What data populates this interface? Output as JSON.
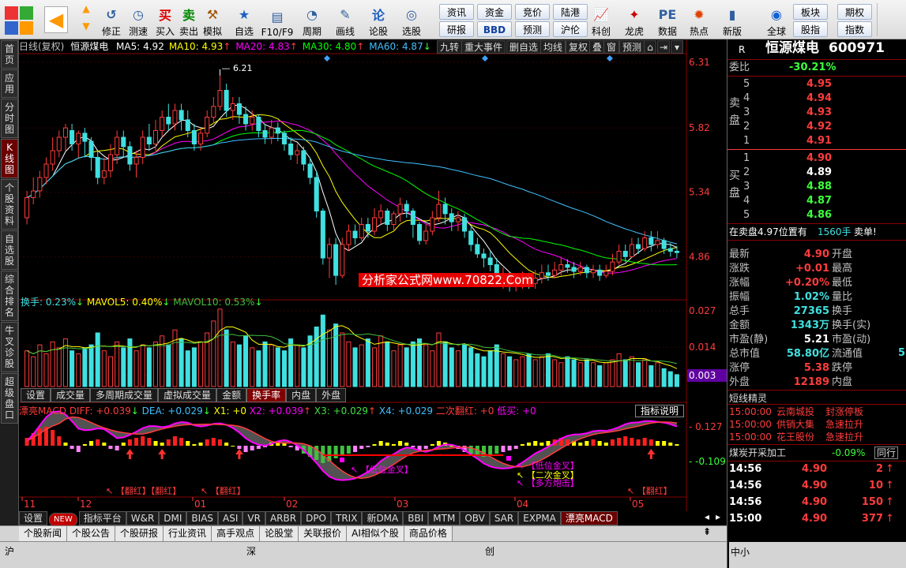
{
  "toolbar": {
    "buttons": [
      {
        "label": "修正",
        "icon": "undo-icon"
      },
      {
        "label": "测速",
        "icon": "timer-icon"
      },
      {
        "label": "买入",
        "icon": "buy-icon"
      },
      {
        "label": "卖出",
        "icon": "sell-icon"
      },
      {
        "label": "模拟",
        "icon": "hammer-icon"
      },
      {
        "label": "自选",
        "icon": "star-icon"
      },
      {
        "label": "F10/F9",
        "icon": "f10-icon"
      },
      {
        "label": "周期",
        "icon": "period-icon"
      },
      {
        "label": "画线",
        "icon": "pencil-icon"
      },
      {
        "label": "论股",
        "icon": "forum-icon"
      },
      {
        "label": "选股",
        "icon": "screener-icon"
      },
      {
        "label": "资讯"
      },
      {
        "label": "研报"
      },
      {
        "label": "资金"
      },
      {
        "label": "BBD"
      },
      {
        "label": "竞价"
      },
      {
        "label": "预测"
      },
      {
        "label": "陆港"
      },
      {
        "label": "沪伦"
      },
      {
        "label": "科创",
        "icon": "chart-icon"
      },
      {
        "label": "龙虎",
        "icon": "dragon-icon"
      },
      {
        "label": "数据",
        "icon": "pe-icon"
      },
      {
        "label": "热点",
        "icon": "hot-icon"
      },
      {
        "label": "新版",
        "icon": "new-icon"
      },
      {
        "label": "全球",
        "icon": "globe-icon"
      },
      {
        "label": "板块"
      },
      {
        "label": "指数"
      },
      {
        "label": "股指"
      },
      {
        "label": "期权"
      }
    ]
  },
  "leftnav": [
    "首页",
    "应用",
    "分时图",
    "K线图",
    "个股资料",
    "自选股",
    "综合排名",
    "牛叉诊股",
    "超级盘口"
  ],
  "chart_header": {
    "period": "日线(复权)",
    "stock": "恒源煤电",
    "ma": [
      {
        "name": "MA5",
        "value": "4.92",
        "color": "#ffffff",
        "dir": ""
      },
      {
        "name": "MA10",
        "value": "4.93",
        "color": "#ffff00",
        "dir": "↑"
      },
      {
        "name": "MA20",
        "value": "4.83",
        "color": "#ff00ff",
        "dir": "↑"
      },
      {
        "name": "MA30",
        "value": "4.80",
        "color": "#00ff00",
        "dir": "↑"
      },
      {
        "name": "MA60",
        "value": "4.87",
        "color": "#40c0ff",
        "dir": "↓"
      }
    ],
    "tabs": [
      "九转",
      "重大事件",
      "删自选",
      "均线",
      "复权",
      "叠",
      "窗",
      "预测"
    ]
  },
  "price_axis": [
    "6.31",
    "5.82",
    "5.34",
    "4.86"
  ],
  "high_label": "6.21",
  "watermark": "分析家公式网www.70822.Com",
  "volume": {
    "label": "换手: 0.23%",
    "mavol5": "MAVOL5: 0.40%",
    "mavol10": "MAVOL10: 0.53%",
    "axis": [
      "0.027",
      "0.014",
      "0.003"
    ]
  },
  "subtabs": [
    "设置",
    "成交量",
    "多周期成交量",
    "虚拟成交量",
    "金额",
    "换手率",
    "内盘",
    "外盘"
  ],
  "macd": {
    "title": "漂亮MACD",
    "diff": "DIFF: +0.039",
    "dea": "DEA: +0.029",
    "x1": "X1: +0",
    "x2": "X2: +0.039",
    "x3": "X3: +0.029",
    "x4": "X4: +0.029",
    "ercizh": "二次翻红: +0",
    "dimai": "低买: +0",
    "explain": "指标说明",
    "axis": [
      "0.127",
      "-0.109"
    ],
    "signals": [
      "【翻红】【翻红】",
      "【翻红】",
      "【低位金叉】",
      "【低位金叉】",
      "【二次金叉】",
      "【多方炮击】",
      "【翻红】"
    ]
  },
  "date_axis": [
    "11",
    "12",
    "01",
    "02",
    "03",
    "04",
    "05"
  ],
  "bottom_tabs": [
    "设置",
    "NEW",
    "指标平台",
    "W&R",
    "DMI",
    "BIAS",
    "ASI",
    "VR",
    "ARBR",
    "DPO",
    "TRIX",
    "新DMA",
    "BBI",
    "MTM",
    "OBV",
    "SAR",
    "EXPMA",
    "漂亮MACD"
  ],
  "content_tabs": [
    "个股新闻",
    "个股公告",
    "个股研报",
    "行业资讯",
    "高手观点",
    "论股堂",
    "关联报价",
    "AI相似个股",
    "商品价格"
  ],
  "status": {
    "sh": "沪",
    "sz": "深",
    "cy": "创"
  },
  "quote": {
    "badge": "R",
    "name": "恒源煤电",
    "code": "600971",
    "weibi_label": "委比",
    "weibi": "-30.21%",
    "sell_label": "卖盘",
    "buy_label": "买盘",
    "sells": [
      {
        "n": "5",
        "p": "4.95"
      },
      {
        "n": "4",
        "p": "4.94"
      },
      {
        "n": "3",
        "p": "4.93"
      },
      {
        "n": "2",
        "p": "4.92"
      },
      {
        "n": "1",
        "p": "4.91"
      }
    ],
    "buys": [
      {
        "n": "1",
        "p": "4.90"
      },
      {
        "n": "2",
        "p": "4.89"
      },
      {
        "n": "3",
        "p": "4.88"
      },
      {
        "n": "4",
        "p": "4.87"
      },
      {
        "n": "5",
        "p": "4.86"
      }
    ],
    "order_line": "在卖盘4.97位置有",
    "order_qty": "1560手",
    "order_tag": "卖单!",
    "stats": [
      {
        "l": "最新",
        "v": "4.90",
        "vc": "red",
        "r": "开盘"
      },
      {
        "l": "涨跌",
        "v": "+0.01",
        "vc": "red",
        "r": "最高"
      },
      {
        "l": "涨幅",
        "v": "+0.20%",
        "vc": "red",
        "r": "最低"
      },
      {
        "l": "振幅",
        "v": "1.02%",
        "vc": "cyan",
        "r": "量比"
      },
      {
        "l": "总手",
        "v": "27365",
        "vc": "cyan",
        "r": "换手"
      },
      {
        "l": "金额",
        "v": "1343万",
        "vc": "cyan",
        "r": "换手(实)"
      },
      {
        "l": "市盈(静)",
        "v": "5.21",
        "vc": "white",
        "r": "市盈(动)"
      },
      {
        "l": "总市值",
        "v": "58.80亿",
        "vc": "cyan",
        "r": "流通值"
      },
      {
        "l": "涨停",
        "v": "5.38",
        "vc": "red",
        "r": "跌停"
      },
      {
        "l": "外盘",
        "v": "12189",
        "vc": "red",
        "r": "内盘"
      }
    ],
    "short_title": "短线精灵",
    "alerts": [
      {
        "t": "15:00:00",
        "s": "云南城投",
        "e": "封涨停板"
      },
      {
        "t": "15:00:00",
        "s": "供销大集",
        "e": "急速拉升"
      },
      {
        "t": "15:00:00",
        "s": "花王股份",
        "e": "急速拉升"
      }
    ],
    "sector": "煤炭开采加工",
    "sector_pct": "-0.09%",
    "sector_btn": "同行",
    "ticks": [
      {
        "t": "14:56",
        "p": "4.90",
        "q": "2",
        "d": "↑"
      },
      {
        "t": "14:56",
        "p": "4.90",
        "q": "10",
        "d": "↑"
      },
      {
        "t": "14:56",
        "p": "4.90",
        "q": "150",
        "d": "↑"
      },
      {
        "t": "15:00",
        "p": "4.90",
        "q": "377",
        "d": "↑"
      }
    ],
    "footer": "中小"
  },
  "chart_data": {
    "type": "candlestick",
    "title": "日线(复权) 恒源煤电",
    "yaxis_ticks": [
      6.31,
      5.82,
      5.34,
      4.86
    ],
    "ylim": [
      4.55,
      6.35
    ],
    "x_month_labels": [
      "11",
      "12",
      "01",
      "02",
      "03",
      "04",
      "05"
    ],
    "candles": [
      [
        5.15,
        5.3,
        5.35,
        5.1
      ],
      [
        5.3,
        5.35,
        5.45,
        5.25
      ],
      [
        5.35,
        5.45,
        5.5,
        5.3
      ],
      [
        5.45,
        5.55,
        5.6,
        5.4
      ],
      [
        5.55,
        5.65,
        5.75,
        5.5
      ],
      [
        5.65,
        5.75,
        5.8,
        5.6
      ],
      [
        5.75,
        5.82,
        5.85,
        5.65
      ],
      [
        5.8,
        5.7,
        5.85,
        5.65
      ],
      [
        5.7,
        5.78,
        5.8,
        5.6
      ],
      [
        5.78,
        5.72,
        5.82,
        5.6
      ],
      [
        5.72,
        5.6,
        5.75,
        5.5
      ],
      [
        5.6,
        5.45,
        5.65,
        5.4
      ],
      [
        5.45,
        5.5,
        5.6,
        5.4
      ],
      [
        5.5,
        5.62,
        5.7,
        5.45
      ],
      [
        5.62,
        5.75,
        5.8,
        5.55
      ],
      [
        5.75,
        5.68,
        5.8,
        5.6
      ],
      [
        5.68,
        5.55,
        5.72,
        5.5
      ],
      [
        5.55,
        5.6,
        5.65,
        5.45
      ],
      [
        5.6,
        5.75,
        5.8,
        5.55
      ],
      [
        5.75,
        5.7,
        5.85,
        5.65
      ],
      [
        5.7,
        5.8,
        5.88,
        5.65
      ],
      [
        5.8,
        5.9,
        5.95,
        5.75
      ],
      [
        5.9,
        5.85,
        6.0,
        5.8
      ],
      [
        5.85,
        5.95,
        6.0,
        5.8
      ],
      [
        5.95,
        5.88,
        6.0,
        5.8
      ],
      [
        5.88,
        5.8,
        5.95,
        5.75
      ],
      [
        5.8,
        5.7,
        5.85,
        5.65
      ],
      [
        5.7,
        5.78,
        5.82,
        5.65
      ],
      [
        5.78,
        5.9,
        5.95,
        5.75
      ],
      [
        5.9,
        5.98,
        6.05,
        5.85
      ],
      [
        5.98,
        6.1,
        6.21,
        5.95
      ],
      [
        6.1,
        5.95,
        6.15,
        5.9
      ],
      [
        5.95,
        6.0,
        6.05,
        5.88
      ],
      [
        6.0,
        5.92,
        6.05,
        5.85
      ],
      [
        5.92,
        5.85,
        5.98,
        5.8
      ],
      [
        5.85,
        5.9,
        5.95,
        5.8
      ],
      [
        5.9,
        5.8,
        5.92,
        5.75
      ],
      [
        5.8,
        5.75,
        5.85,
        5.7
      ],
      [
        5.75,
        5.82,
        5.88,
        5.7
      ],
      [
        5.82,
        5.78,
        5.86,
        5.72
      ],
      [
        5.78,
        5.7,
        5.8,
        5.65
      ],
      [
        5.7,
        5.62,
        5.75,
        5.58
      ],
      [
        5.62,
        5.65,
        5.7,
        5.55
      ],
      [
        5.65,
        5.55,
        5.68,
        5.5
      ],
      [
        5.55,
        5.45,
        5.6,
        5.4
      ],
      [
        5.45,
        5.2,
        5.5,
        5.15
      ],
      [
        5.2,
        4.85,
        5.22,
        4.8
      ],
      [
        4.85,
        4.95,
        5.0,
        4.7
      ],
      [
        4.95,
        4.72,
        5.0,
        4.65
      ],
      [
        4.72,
        4.95,
        5.0,
        4.7
      ],
      [
        4.95,
        5.05,
        5.1,
        4.9
      ],
      [
        5.05,
        5.0,
        5.1,
        4.95
      ],
      [
        5.0,
        5.1,
        5.15,
        4.98
      ],
      [
        5.1,
        5.05,
        5.15,
        5.0
      ],
      [
        5.05,
        5.15,
        5.22,
        5.02
      ],
      [
        5.15,
        5.2,
        5.25,
        5.1
      ],
      [
        5.2,
        5.1,
        5.22,
        5.05
      ],
      [
        5.1,
        5.18,
        5.2,
        5.05
      ],
      [
        5.18,
        5.25,
        5.3,
        5.12
      ],
      [
        5.25,
        5.2,
        5.28,
        5.15
      ],
      [
        5.2,
        5.1,
        5.22,
        5.0
      ],
      [
        5.1,
        4.98,
        5.12,
        4.95
      ],
      [
        4.98,
        5.05,
        5.1,
        4.95
      ],
      [
        5.05,
        5.15,
        5.2,
        5.02
      ],
      [
        5.15,
        5.25,
        5.35,
        5.12
      ],
      [
        5.25,
        5.18,
        5.3,
        5.1
      ],
      [
        5.18,
        5.12,
        5.22,
        5.05
      ],
      [
        5.12,
        5.15,
        5.2,
        5.05
      ],
      [
        5.15,
        5.05,
        5.18,
        5.0
      ],
      [
        5.05,
        4.95,
        5.08,
        4.9
      ],
      [
        4.95,
        4.88,
        5.0,
        4.85
      ],
      [
        4.88,
        4.85,
        4.92,
        4.78
      ],
      [
        4.85,
        4.8,
        4.9,
        4.75
      ],
      [
        4.8,
        4.7,
        4.85,
        4.65
      ],
      [
        4.7,
        4.72,
        4.78,
        4.62
      ],
      [
        4.72,
        4.65,
        4.75,
        4.6
      ],
      [
        4.65,
        4.68,
        4.72,
        4.6
      ],
      [
        4.68,
        4.7,
        4.75,
        4.62
      ],
      [
        4.7,
        4.66,
        4.74,
        4.62
      ],
      [
        4.66,
        4.7,
        4.76,
        4.62
      ],
      [
        4.7,
        4.74,
        4.8,
        4.66
      ],
      [
        4.74,
        4.72,
        4.8,
        4.68
      ],
      [
        4.72,
        4.76,
        4.82,
        4.7
      ],
      [
        4.76,
        4.8,
        4.85,
        4.72
      ],
      [
        4.8,
        4.78,
        4.84,
        4.74
      ],
      [
        4.78,
        4.75,
        4.82,
        4.7
      ],
      [
        4.75,
        4.78,
        4.82,
        4.72
      ],
      [
        4.78,
        4.74,
        4.8,
        4.7
      ],
      [
        4.74,
        4.76,
        4.8,
        4.7
      ],
      [
        4.76,
        4.72,
        4.8,
        4.68
      ],
      [
        4.72,
        4.75,
        4.8,
        4.7
      ],
      [
        4.75,
        4.82,
        4.88,
        4.72
      ],
      [
        4.82,
        4.9,
        4.95,
        4.8
      ],
      [
        4.9,
        4.86,
        4.95,
        4.82
      ],
      [
        4.86,
        4.95,
        5.0,
        4.85
      ],
      [
        4.95,
        4.92,
        5.0,
        4.88
      ],
      [
        4.92,
        5.0,
        5.05,
        4.9
      ],
      [
        5.0,
        4.95,
        5.05,
        4.9
      ],
      [
        4.95,
        4.98,
        5.05,
        4.92
      ],
      [
        4.98,
        4.92,
        5.0,
        4.88
      ],
      [
        4.92,
        4.9,
        4.96,
        4.86
      ],
      [
        4.9,
        4.89,
        4.94,
        4.85
      ]
    ],
    "volume_pct": [
      1.2,
      1.0,
      1.4,
      1.1,
      1.5,
      1.3,
      1.6,
      1.2,
      1.1,
      1.3,
      1.4,
      1.8,
      1.2,
      1.0,
      1.5,
      1.3,
      1.6,
      1.2,
      1.4,
      1.3,
      1.5,
      1.7,
      1.4,
      1.9,
      1.6,
      1.2,
      1.3,
      1.5,
      1.8,
      2.2,
      2.6,
      1.9,
      1.5,
      1.4,
      1.7,
      1.3,
      1.2,
      1.5,
      1.4,
      1.3,
      1.2,
      1.6,
      1.4,
      1.3,
      1.7,
      2.0,
      2.4,
      1.9,
      2.1,
      1.8,
      1.5,
      1.3,
      1.4,
      1.6,
      1.3,
      1.7,
      1.5,
      1.2,
      1.4,
      1.3,
      1.5,
      1.6,
      1.4,
      1.2,
      1.8,
      1.5,
      1.3,
      1.2,
      1.4,
      1.3,
      1.1,
      1.0,
      1.2,
      1.4,
      1.1,
      1.0,
      0.9,
      1.0,
      1.1,
      0.9,
      1.0,
      1.1,
      0.9,
      0.8,
      1.0,
      0.9,
      0.8,
      0.9,
      0.8,
      0.7,
      0.8,
      0.9,
      1.1,
      0.9,
      1.0,
      0.8,
      0.9,
      0.7,
      0.8,
      0.6,
      0.5,
      0.4
    ],
    "macd_hist": [
      0.05,
      0.08,
      0.11,
      0.12,
      0.1,
      0.06,
      0.02,
      -0.02,
      -0.04,
      0.01,
      0.03,
      0.04,
      0.02,
      -0.02,
      -0.03,
      0.02,
      0.04,
      0.05,
      0.06,
      0.05,
      0.03,
      0.02,
      0.04,
      0.06,
      0.05,
      0.03,
      0.01,
      0.02,
      0.04,
      0.05,
      0.04,
      0.02,
      0.0,
      -0.02,
      -0.04,
      -0.03,
      -0.02,
      -0.01,
      0.02,
      0.03,
      0.02,
      -0.01,
      -0.03,
      -0.05,
      -0.07,
      -0.09,
      -0.11,
      -0.1,
      -0.08,
      -0.06,
      -0.05,
      -0.04,
      -0.02,
      -0.01,
      0.01,
      0.03,
      0.02,
      0.01,
      0.03,
      0.02,
      -0.01,
      -0.03,
      -0.02,
      0.01,
      0.03,
      0.02,
      0.0,
      -0.02,
      -0.04,
      -0.05,
      -0.06,
      -0.07,
      -0.06,
      -0.05,
      -0.04,
      -0.03,
      -0.02,
      0.01,
      0.02,
      0.03,
      0.02,
      0.03,
      0.04,
      0.05,
      0.04,
      0.03,
      0.02,
      0.03,
      0.04,
      0.03,
      0.02,
      0.04,
      0.05,
      0.06,
      0.05,
      0.04,
      0.05,
      0.04,
      0.03,
      0.03,
      0.02,
      0.01
    ]
  }
}
